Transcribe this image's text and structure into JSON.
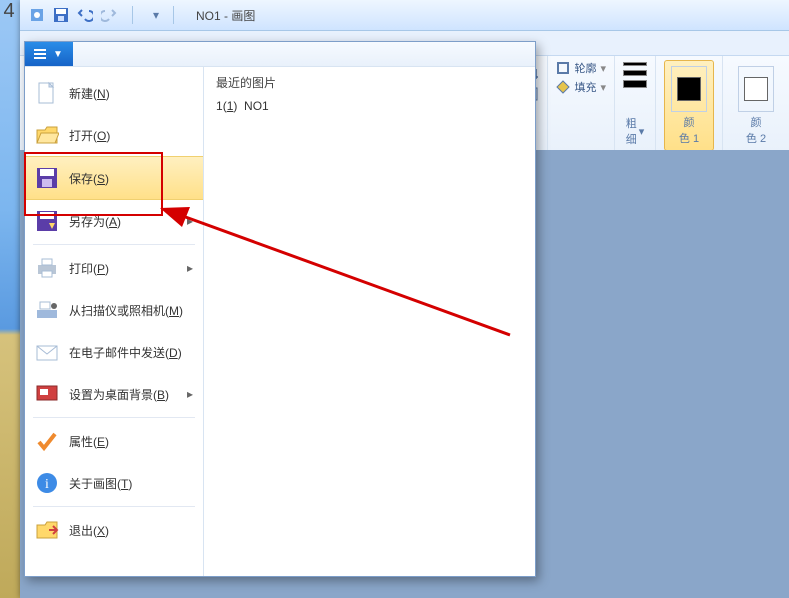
{
  "titlebar": {
    "title": "NO1 - 画图"
  },
  "file_menu": {
    "items": [
      {
        "label": "新建",
        "hot": "N",
        "icon": "new"
      },
      {
        "label": "打开",
        "hot": "O",
        "icon": "open"
      },
      {
        "label": "保存",
        "hot": "S",
        "icon": "save",
        "selected": true
      },
      {
        "label": "另存为",
        "hot": "A",
        "icon": "saveas",
        "submenu": true
      },
      {
        "label": "打印",
        "hot": "P",
        "icon": "print",
        "submenu": true
      },
      {
        "label": "从扫描仪或照相机",
        "hot": "M",
        "icon": "scanner"
      },
      {
        "label": "在电子邮件中发送",
        "hot": "D",
        "icon": "email"
      },
      {
        "label": "设置为桌面背景",
        "hot": "B",
        "icon": "desktop",
        "submenu": true
      },
      {
        "label": "属性",
        "hot": "E",
        "icon": "check"
      },
      {
        "label": "关于画图",
        "hot": "T",
        "icon": "info"
      },
      {
        "label": "退出",
        "hot": "X",
        "icon": "exit"
      }
    ],
    "recent_header": "最近的图片",
    "recent": [
      {
        "index": "1",
        "index_hot": "1",
        "name": "NO1"
      }
    ]
  },
  "ribbon": {
    "group_shapes": [
      {
        "label": "轮廓",
        "icon": "outline"
      },
      {
        "label": "填充",
        "icon": "fill"
      }
    ],
    "group_stroke_label": "粗\n细",
    "group_color1_label": "颜\n色 1",
    "group_color2_label": "颜\n色 2",
    "colors": {
      "c1": "#000000",
      "c2": "#ffffff"
    }
  },
  "left_badge": "4"
}
